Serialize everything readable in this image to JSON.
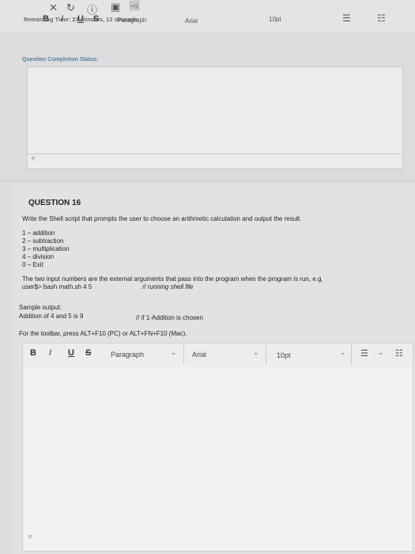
{
  "top_toolbar": {
    "close_icon": "✕",
    "redo_icon": "↻",
    "info_icon": "ⓘ",
    "doc_icon": "▣",
    "image_icon": "🖼",
    "bold": "B",
    "italic": "I",
    "underline": "U",
    "strike": "S",
    "paragraph": "Paragraph",
    "font": "Arial",
    "size": "10pt",
    "list_icon": "☰",
    "list2_icon": "☷"
  },
  "timer": "Remaining Time: 23 minutes, 13 seconds.",
  "completion_status": "Question Completion Status:",
  "editor1_path": "P",
  "question": {
    "title": "QUESTION 16",
    "prompt": "Write the Shell script that prompts the user to choose an arithmetic calculation and output the result.",
    "options": [
      "1 – addition",
      "2 – subtraction",
      "3 – multiplication",
      "4 – division",
      "0 – Exit"
    ],
    "args_line1": "The two input numbers are the external arguments that pass into the program when the program is run, e.g.",
    "args_cmd": "user$> bash math.sh 4 5",
    "args_comment": "// running shell file",
    "sample_label": "Sample output:",
    "sample_line": "Addition of 4 and 5 is 9",
    "sample_comment": "// if 1-Addition is chosen",
    "toolbar_hint": "For the toolbar, press ALT+F10 (PC) or ALT+FN+F10 (Mac)."
  },
  "editor_toolbar": {
    "bold": "B",
    "italic": "I",
    "underline": "U",
    "strike": "S",
    "paragraph": "Paragraph",
    "font": "Arial",
    "size": "10pt",
    "chevron": "⌄",
    "list_icon": "☰",
    "list2_icon": "☷"
  },
  "editor2_path": "P"
}
